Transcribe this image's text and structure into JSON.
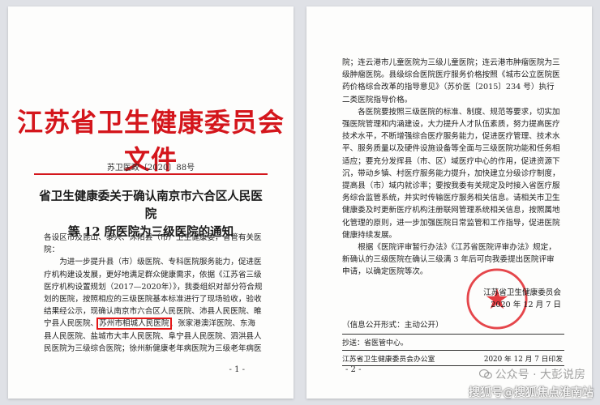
{
  "page1": {
    "header": "江苏省卫生健康委员会文件",
    "doc_number": "苏卫医政〔2020〕88号",
    "title_line1": "省卫生健康委关于确认南京市六合区人民医院",
    "title_line2": "等 12 所医院为三级医院的通知",
    "salutation": "各设区市及昆山、泰兴、沭阳县（市）卫生健康委，省管有关医院：",
    "para_before_highlight": "为进一步提升县（市）级医院、专科医院服务能力，促进医疗机构建设发展，更好地满足群众健康需求，依据《江苏省三级医疗机构设置规划（2017—2020年）》，我委组织对部分符合规划的医院，按照相应的三级医院基本标准进行了现场验收，验收结果经公示，现确认南京市六合区人民医院、沛县人民医院、睢宁县人民医院、",
    "highlight": "苏州市相城人民医院",
    "para_after_highlight": "、张家港澳洋医院、东海县人民医院、盐城市大丰人民医院、阜宁县人民医院、泗洪县人民医院为三级综合医院；徐州新健康老年病医院为三级老年病医",
    "page_number": "- 1 -"
  },
  "page2": {
    "para_top": "院；连云港市儿童医院为三级儿童医院；连云港市肿瘤医院为三级肿瘤医院。县级综合医院医疗服务价格按照《城市公立医院医药价格综合改革的指导意见》（苏价医〔2015〕234 号）执行二类医院指导价格。",
    "para_mid": "各医院要按照三级医院的标准、制度、规范等要求，切实加强医院管理和内涵建设，大力提升人才队伍素质，努力提高医疗技术水平，不断增强综合医疗服务能力，促进医疗管理、技术水平、服务质量以及硬件设施设备等全面与三级医院功能和任务相适应；要充分发挥县（市、区）域医疗中心的作用，促进资源下沉，带动乡镇、村医疗服务能力提升，加快建立分级诊疗制度，提高县（市）域内就诊率；要按我委有关规定及时接入省医疗服务综合监管系统，并实时传输医疗服务相关信息。请相关市卫生健康委及时更新医疗机构注册联网管理系统相关信息，按照属地化管理的原则，进一步加强医院日常监管和工作指导，促进医院健康持续发展。",
    "para_end": "根据《医院评审暂行办法》《江苏省医院评审办法》规定，新确认的三级医院在确认三级满 3 年后可向我委提出医院评审申请，以确定医院等次。",
    "signature_org": "江苏省卫生健康委员会",
    "signature_date": "2020 年 12 月 7 日",
    "seal_text": "江苏省卫生健康委员会",
    "disclosure": "（信息公开形式：主动公开）",
    "cc": "抄送：省医管中心。",
    "footer_org": "江苏省卫生健康委员会办公室",
    "footer_date": "2020 年 12 月 7 日印发",
    "page_number": "- 2 -"
  },
  "watermarks": {
    "gongzhonghao": "公众号 · 大彭说房",
    "sohu": "搜狐号@搜狐焦点淮南站"
  },
  "colors": {
    "header_red": "#d4161c",
    "highlight_box": "#e31616",
    "seal_red": "#e0262b"
  }
}
